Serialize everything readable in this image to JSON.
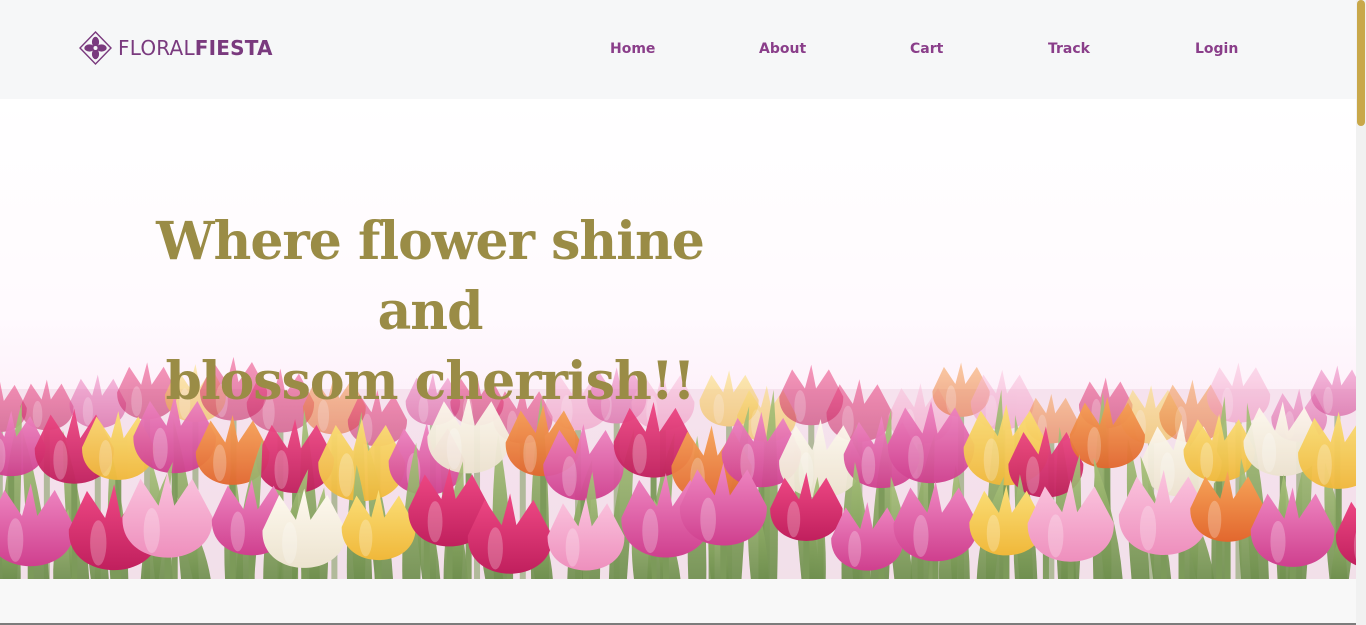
{
  "brand": {
    "name_light": "FLORAL",
    "name_bold": "FIESTA",
    "logo_icon": "flower-diamond-logo",
    "color": "#7a3a7e"
  },
  "nav": {
    "items": [
      {
        "label": "Home"
      },
      {
        "label": "About"
      },
      {
        "label": "Cart"
      },
      {
        "label": "Track"
      },
      {
        "label": "Login"
      }
    ],
    "color": "#8a3e8a"
  },
  "hero": {
    "heading_line1": "Where flower shine and",
    "heading_line2": "blossom cherrish!!",
    "heading_color": "#9a8c46",
    "background_image": "tulip-field"
  },
  "scrollbar": {
    "thumb_color": "#c9a84a"
  }
}
